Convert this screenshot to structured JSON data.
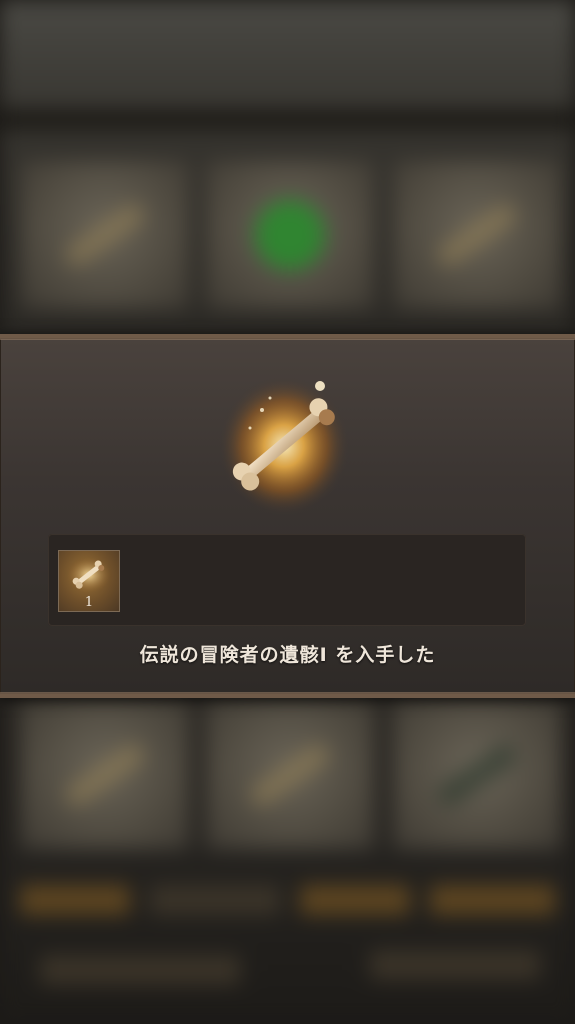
{
  "reward_popup": {
    "item_name_message": "伝説の冒険者の遺骸Ⅰ を入手した",
    "item": {
      "icon": "bone-icon",
      "count": "1"
    }
  },
  "colors": {
    "accent_frame": "#6f5a48",
    "item_glow": "#f0a030",
    "text": "#efe6da"
  }
}
